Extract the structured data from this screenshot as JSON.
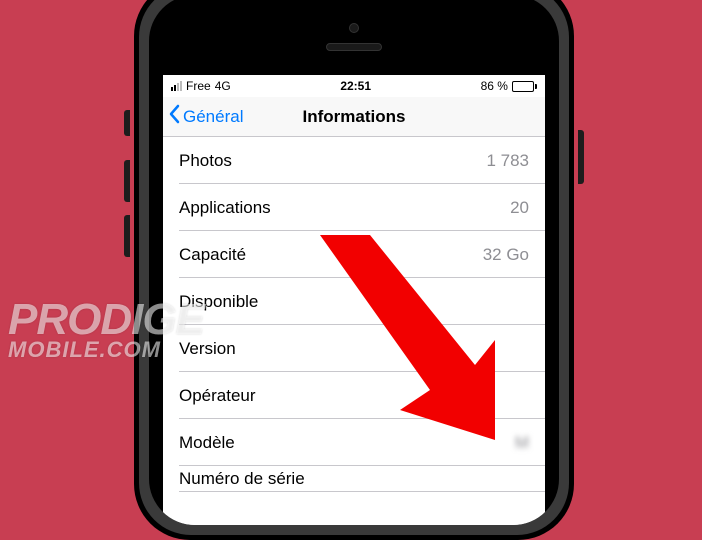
{
  "status": {
    "carrier": "Free",
    "network": "4G",
    "time": "22:51",
    "battery_pct": "86 %"
  },
  "nav": {
    "back_label": "Général",
    "title": "Informations"
  },
  "rows": [
    {
      "label": "Photos",
      "value": "1 783"
    },
    {
      "label": "Applications",
      "value": "20"
    },
    {
      "label": "Capacité",
      "value": "32 Go"
    },
    {
      "label": "Disponible",
      "value": ""
    },
    {
      "label": "Version",
      "value": ""
    },
    {
      "label": "Opérateur",
      "value": ""
    },
    {
      "label": "Modèle",
      "value": "M"
    },
    {
      "label": "Numéro de série",
      "value": ""
    }
  ],
  "watermark": {
    "line1": "PRODIGE",
    "line2": "MOBILE.COM"
  },
  "colors": {
    "background": "#c83e52",
    "ios_blue": "#007aff",
    "arrow": "#f20000"
  }
}
